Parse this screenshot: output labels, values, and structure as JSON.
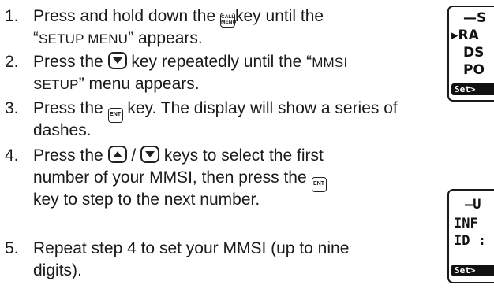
{
  "steps": [
    {
      "number": "1.",
      "lines": [
        {
          "a": "Press and hold down the ",
          "key": "CALL MENU",
          "b": "key until the"
        },
        {
          "a": "“",
          "sc": "SETUP MENU",
          "b": "” appears."
        }
      ]
    },
    {
      "number": "2.",
      "lines": [
        {
          "a": "Press the ",
          "key": "down-arrow",
          "b": " key repeatedly until the “",
          "sc": "MMSI"
        },
        {
          "sc": "SETUP",
          "b": "” menu appears."
        }
      ]
    },
    {
      "number": "3.",
      "lines": [
        {
          "a": "Press the ",
          "key": "ENT",
          "b": " key. The display will show a series of"
        },
        {
          "a": "dashes."
        }
      ]
    },
    {
      "number": "4.",
      "lines": [
        {
          "a": "Press the ",
          "key1": "up-arrow",
          "mid": " / ",
          "key2": "down-arrow",
          "b": " keys to select the first"
        },
        {
          "a": "number of your MMSI, then press the ",
          "key": "ENT"
        },
        {
          "a": "key to step to the next number."
        }
      ]
    },
    {
      "number": "5.",
      "lines": [
        {
          "a": "Repeat step 4 to set your MMSI (up to nine"
        },
        {
          "a": "digits)."
        }
      ]
    }
  ],
  "keys": {
    "call_menu_top": "CALL",
    "call_menu_bottom": "MENU",
    "ent": "ENT"
  },
  "lcd1": {
    "row1": "—S",
    "row2": "▸RA",
    "row3": "DS",
    "row4": "PO",
    "button": "Set>"
  },
  "lcd2": {
    "row1": "—U",
    "row2": "INF",
    "row3": "ID :",
    "button": "Set>"
  }
}
